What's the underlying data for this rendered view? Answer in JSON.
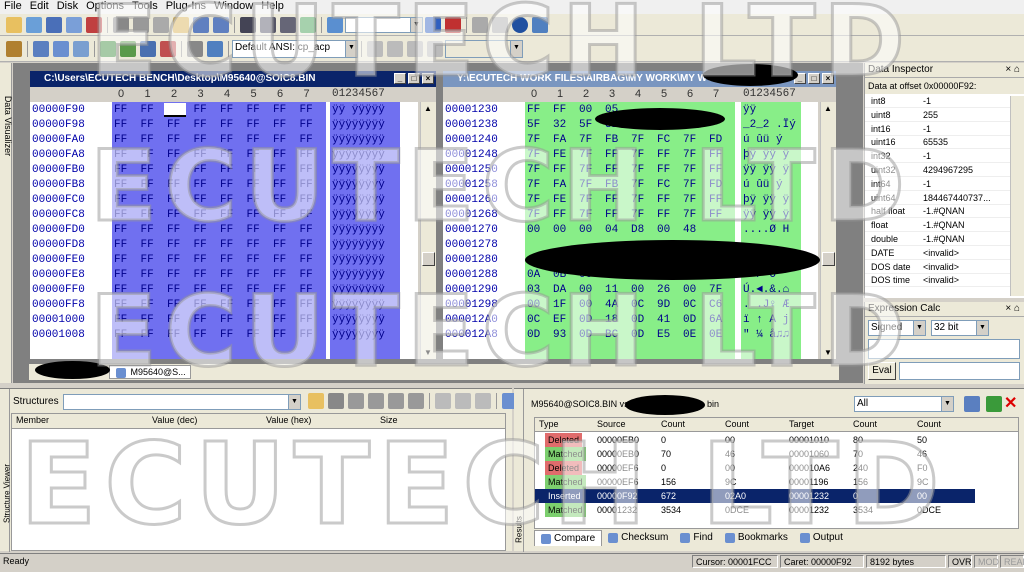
{
  "menu": [
    "File",
    "Edit",
    "Disk",
    "Options",
    "Tools",
    "Plug-Ins",
    "Window",
    "Help"
  ],
  "toolbar2": {
    "encoding": "Default ANSI: cp_acp"
  },
  "sidebar_left": {
    "label": "Data Visualizer"
  },
  "left_editor": {
    "title": "C:\\Users\\ECUTECH BENCH\\Desktop\\M95640@SOIC8.BIN",
    "col_digits": [
      "0",
      "1",
      "2",
      "3",
      "4",
      "5",
      "6",
      "7"
    ],
    "text_hdr": "01234567",
    "tab": "M95640@S...",
    "rows": [
      {
        "off": "00000F90",
        "b": [
          "FF",
          "FF",
          "",
          "FF",
          "FF",
          "FF",
          "FF",
          "FF"
        ],
        "t": "ÿÿ ÿÿÿÿÿ"
      },
      {
        "off": "00000F98",
        "b": [
          "FF",
          "FF",
          "FF",
          "FF",
          "FF",
          "FF",
          "FF",
          "FF"
        ],
        "t": "ÿÿÿÿÿÿÿÿ"
      },
      {
        "off": "00000FA0",
        "b": [
          "FF",
          "FF",
          "FF",
          "FF",
          "FF",
          "FF",
          "FF",
          "FF"
        ],
        "t": "ÿÿÿÿÿÿÿÿ"
      },
      {
        "off": "00000FA8",
        "b": [
          "FF",
          "FF",
          "FF",
          "FF",
          "FF",
          "FF",
          "FF",
          "FF"
        ],
        "t": "ÿÿÿÿÿÿÿÿ"
      },
      {
        "off": "00000FB0",
        "b": [
          "FF",
          "FF",
          "FF",
          "FF",
          "FF",
          "FF",
          "FF",
          "FF"
        ],
        "t": "ÿÿÿÿÿÿÿÿ"
      },
      {
        "off": "00000FB8",
        "b": [
          "FF",
          "FF",
          "FF",
          "FF",
          "FF",
          "FF",
          "FF",
          "FF"
        ],
        "t": "ÿÿÿÿÿÿÿÿ"
      },
      {
        "off": "00000FC0",
        "b": [
          "FF",
          "FF",
          "FF",
          "FF",
          "FF",
          "FF",
          "FF",
          "FF"
        ],
        "t": "ÿÿÿÿÿÿÿÿ"
      },
      {
        "off": "00000FC8",
        "b": [
          "FF",
          "FF",
          "FF",
          "FF",
          "FF",
          "FF",
          "FF",
          "FF"
        ],
        "t": "ÿÿÿÿÿÿÿÿ"
      },
      {
        "off": "00000FD0",
        "b": [
          "FF",
          "FF",
          "FF",
          "FF",
          "FF",
          "FF",
          "FF",
          "FF"
        ],
        "t": "ÿÿÿÿÿÿÿÿ"
      },
      {
        "off": "00000FD8",
        "b": [
          "FF",
          "FF",
          "FF",
          "FF",
          "FF",
          "FF",
          "FF",
          "FF"
        ],
        "t": "ÿÿÿÿÿÿÿÿ"
      },
      {
        "off": "00000FE0",
        "b": [
          "FF",
          "FF",
          "FF",
          "FF",
          "FF",
          "FF",
          "FF",
          "FF"
        ],
        "t": "ÿÿÿÿÿÿÿÿ"
      },
      {
        "off": "00000FE8",
        "b": [
          "FF",
          "FF",
          "FF",
          "FF",
          "FF",
          "FF",
          "FF",
          "FF"
        ],
        "t": "ÿÿÿÿÿÿÿÿ"
      },
      {
        "off": "00000FF0",
        "b": [
          "FF",
          "FF",
          "FF",
          "FF",
          "FF",
          "FF",
          "FF",
          "FF"
        ],
        "t": "ÿÿÿÿÿÿÿÿ"
      },
      {
        "off": "00000FF8",
        "b": [
          "FF",
          "FF",
          "FF",
          "FF",
          "FF",
          "FF",
          "FF",
          "FF"
        ],
        "t": "ÿÿÿÿÿÿÿÿ"
      },
      {
        "off": "00001000",
        "b": [
          "FF",
          "FF",
          "FF",
          "FF",
          "FF",
          "FF",
          "FF",
          "FF"
        ],
        "t": "ÿÿÿÿÿÿÿÿ"
      },
      {
        "off": "00001008",
        "b": [
          "FF",
          "FF",
          "FF",
          "FF",
          "FF",
          "FF",
          "FF",
          "FF"
        ],
        "t": "ÿÿÿÿÿÿÿÿ"
      }
    ]
  },
  "right_editor": {
    "title": "Y:\\ECUTECH WORK FILES\\AIRBAG\\MY WORK\\MY WORK",
    "col_digits": [
      "0",
      "1",
      "2",
      "3",
      "4",
      "5",
      "6",
      "7"
    ],
    "text_hdr": "01234567",
    "rows": [
      {
        "off": "00001230",
        "b": [
          "FF",
          "FF",
          "00",
          "05",
          "",
          "",
          "",
          "",
          ""
        ],
        "t": "ÿÿ"
      },
      {
        "off": "00001238",
        "b": [
          "5F",
          "32",
          "5F",
          "32",
          "",
          "",
          "",
          "",
          ""
        ],
        "t": "_2_2 .Ïý"
      },
      {
        "off": "00001240",
        "b": [
          "7F",
          "FA",
          "7F",
          "FB",
          "7F",
          "FC",
          "7F",
          "FD"
        ],
        "t": "ú ûü ý"
      },
      {
        "off": "00001248",
        "b": [
          "7F",
          "FE",
          "7F",
          "FF",
          "7F",
          "FF",
          "7F",
          "FF"
        ],
        "t": "þÿ ÿÿ ÿ"
      },
      {
        "off": "00001250",
        "b": [
          "7F",
          "FF",
          "7F",
          "FF",
          "7F",
          "FF",
          "7F",
          "FF"
        ],
        "t": "ÿÿ ÿÿ ÿ"
      },
      {
        "off": "00001258",
        "b": [
          "7F",
          "FA",
          "7F",
          "FB",
          "7F",
          "FC",
          "7F",
          "FD"
        ],
        "t": "ú ûü ý"
      },
      {
        "off": "00001260",
        "b": [
          "7F",
          "FE",
          "7F",
          "FF",
          "7F",
          "FF",
          "7F",
          "FF"
        ],
        "t": "þÿ ÿÿ ÿ"
      },
      {
        "off": "00001268",
        "b": [
          "7F",
          "FF",
          "7F",
          "FF",
          "7F",
          "FF",
          "7F",
          "FF"
        ],
        "t": "ÿÿ ÿÿ ÿ"
      },
      {
        "off": "00001270",
        "b": [
          "00",
          "00",
          "00",
          "04",
          "D8",
          "00",
          "48",
          ""
        ],
        "t": "....Ø H"
      },
      {
        "off": "00001278",
        "b": [
          "",
          "",
          "",
          "",
          "",
          "",
          "",
          ""
        ],
        "t": ""
      },
      {
        "off": "00001280",
        "b": [
          "",
          "",
          "",
          "",
          "",
          "",
          "",
          ""
        ],
        "t": ""
      },
      {
        "off": "00001288",
        "b": [
          "0A",
          "0B",
          "06",
          "01",
          "00",
          "50",
          "01",
          "4F"
        ],
        "t": ". P O"
      },
      {
        "off": "00001290",
        "b": [
          "03",
          "DA",
          "00",
          "11",
          "00",
          "26",
          "00",
          "7F"
        ],
        "t": "Ú.◄.&.⌂"
      },
      {
        "off": "00001298",
        "b": [
          "00",
          "1F",
          "00",
          "4A",
          "0C",
          "9D",
          "0C",
          "C6"
        ],
        "t": ". .J♀ Æ"
      },
      {
        "off": "000012A0",
        "b": [
          "0C",
          "EF",
          "0D",
          "18",
          "0D",
          "41",
          "0D",
          "6A"
        ],
        "t": "ï ↑ A j"
      },
      {
        "off": "000012A8",
        "b": [
          "0D",
          "93",
          "0D",
          "BC",
          "0D",
          "E5",
          "0E",
          "0E"
        ],
        "t": "\" ¼ å♫♫"
      }
    ]
  },
  "data_inspector": {
    "title": "Data Inspector",
    "subtitle": "Data at offset 0x00000F92:",
    "rows": [
      {
        "k": "int8",
        "v": "-1"
      },
      {
        "k": "uint8",
        "v": "255"
      },
      {
        "k": "int16",
        "v": "-1"
      },
      {
        "k": "uint16",
        "v": "65535"
      },
      {
        "k": "int32",
        "v": "-1"
      },
      {
        "k": "uint32",
        "v": "4294967295"
      },
      {
        "k": "int64",
        "v": "-1"
      },
      {
        "k": "uint64",
        "v": "184467440737..."
      },
      {
        "k": "half float",
        "v": "-1.#QNAN"
      },
      {
        "k": "float",
        "v": "-1.#QNAN"
      },
      {
        "k": "double",
        "v": "-1.#QNAN"
      },
      {
        "k": "DATE",
        "v": "<invalid>"
      },
      {
        "k": "DOS date",
        "v": "<invalid>"
      },
      {
        "k": "DOS time",
        "v": "<invalid>"
      }
    ]
  },
  "expr_calc": {
    "title": "Expression Calc",
    "signed": "Signed",
    "bits": "32 bit",
    "eval": "Eval"
  },
  "structures": {
    "label": "Structures",
    "side_label": "Structure Viewer",
    "cols": [
      "Member",
      "Value (dec)",
      "Value (hex)",
      "Size"
    ]
  },
  "compare": {
    "title_left": "M95640@SOIC8.BIN vs",
    "title_right": "bin",
    "filter": "All",
    "side_label": "Results",
    "cols": [
      "Type",
      "Source",
      "Count",
      "Count",
      "Target",
      "Count",
      "Count"
    ],
    "rows": [
      {
        "type": "Deleted",
        "src": "00000EB0",
        "c1": "0",
        "c2": "00",
        "tgt": "00001010",
        "c3": "80",
        "c4": "50",
        "color": "#e06c6c"
      },
      {
        "type": "Matched",
        "src": "00000EB0",
        "c1": "70",
        "c2": "46",
        "tgt": "00001060",
        "c3": "70",
        "c4": "46",
        "color": "#7ccf6e"
      },
      {
        "type": "Deleted",
        "src": "00000EF6",
        "c1": "0",
        "c2": "00",
        "tgt": "000010A6",
        "c3": "240",
        "c4": "F0",
        "color": "#e06c6c"
      },
      {
        "type": "Matched",
        "src": "00000EF6",
        "c1": "156",
        "c2": "9C",
        "tgt": "00001196",
        "c3": "156",
        "c4": "9C",
        "color": "#7ccf6e"
      },
      {
        "type": "Inserted",
        "src": "00000F92",
        "c1": "672",
        "c2": "02A0",
        "tgt": "00001232",
        "c3": "0",
        "c4": "00",
        "color": "#0a246a"
      },
      {
        "type": "Matched",
        "src": "00001232",
        "c1": "3534",
        "c2": "0DCE",
        "tgt": "00001232",
        "c3": "3534",
        "c4": "0DCE",
        "color": "#7ccf6e"
      }
    ],
    "tabs": [
      "Compare",
      "Checksum",
      "Find",
      "Bookmarks",
      "Output"
    ]
  },
  "status": {
    "ready": "Ready",
    "cursor": "Cursor: 00001FCC",
    "caret": "Caret: 00000F92",
    "size": "8192 bytes",
    "ovr": "OVR",
    "mod": "MOD",
    "read": "READ"
  },
  "watermark": [
    "ECUTECH LTD",
    "ECUTECH LTD",
    "ECUTECH LTD",
    "ECUTECH LTD"
  ]
}
